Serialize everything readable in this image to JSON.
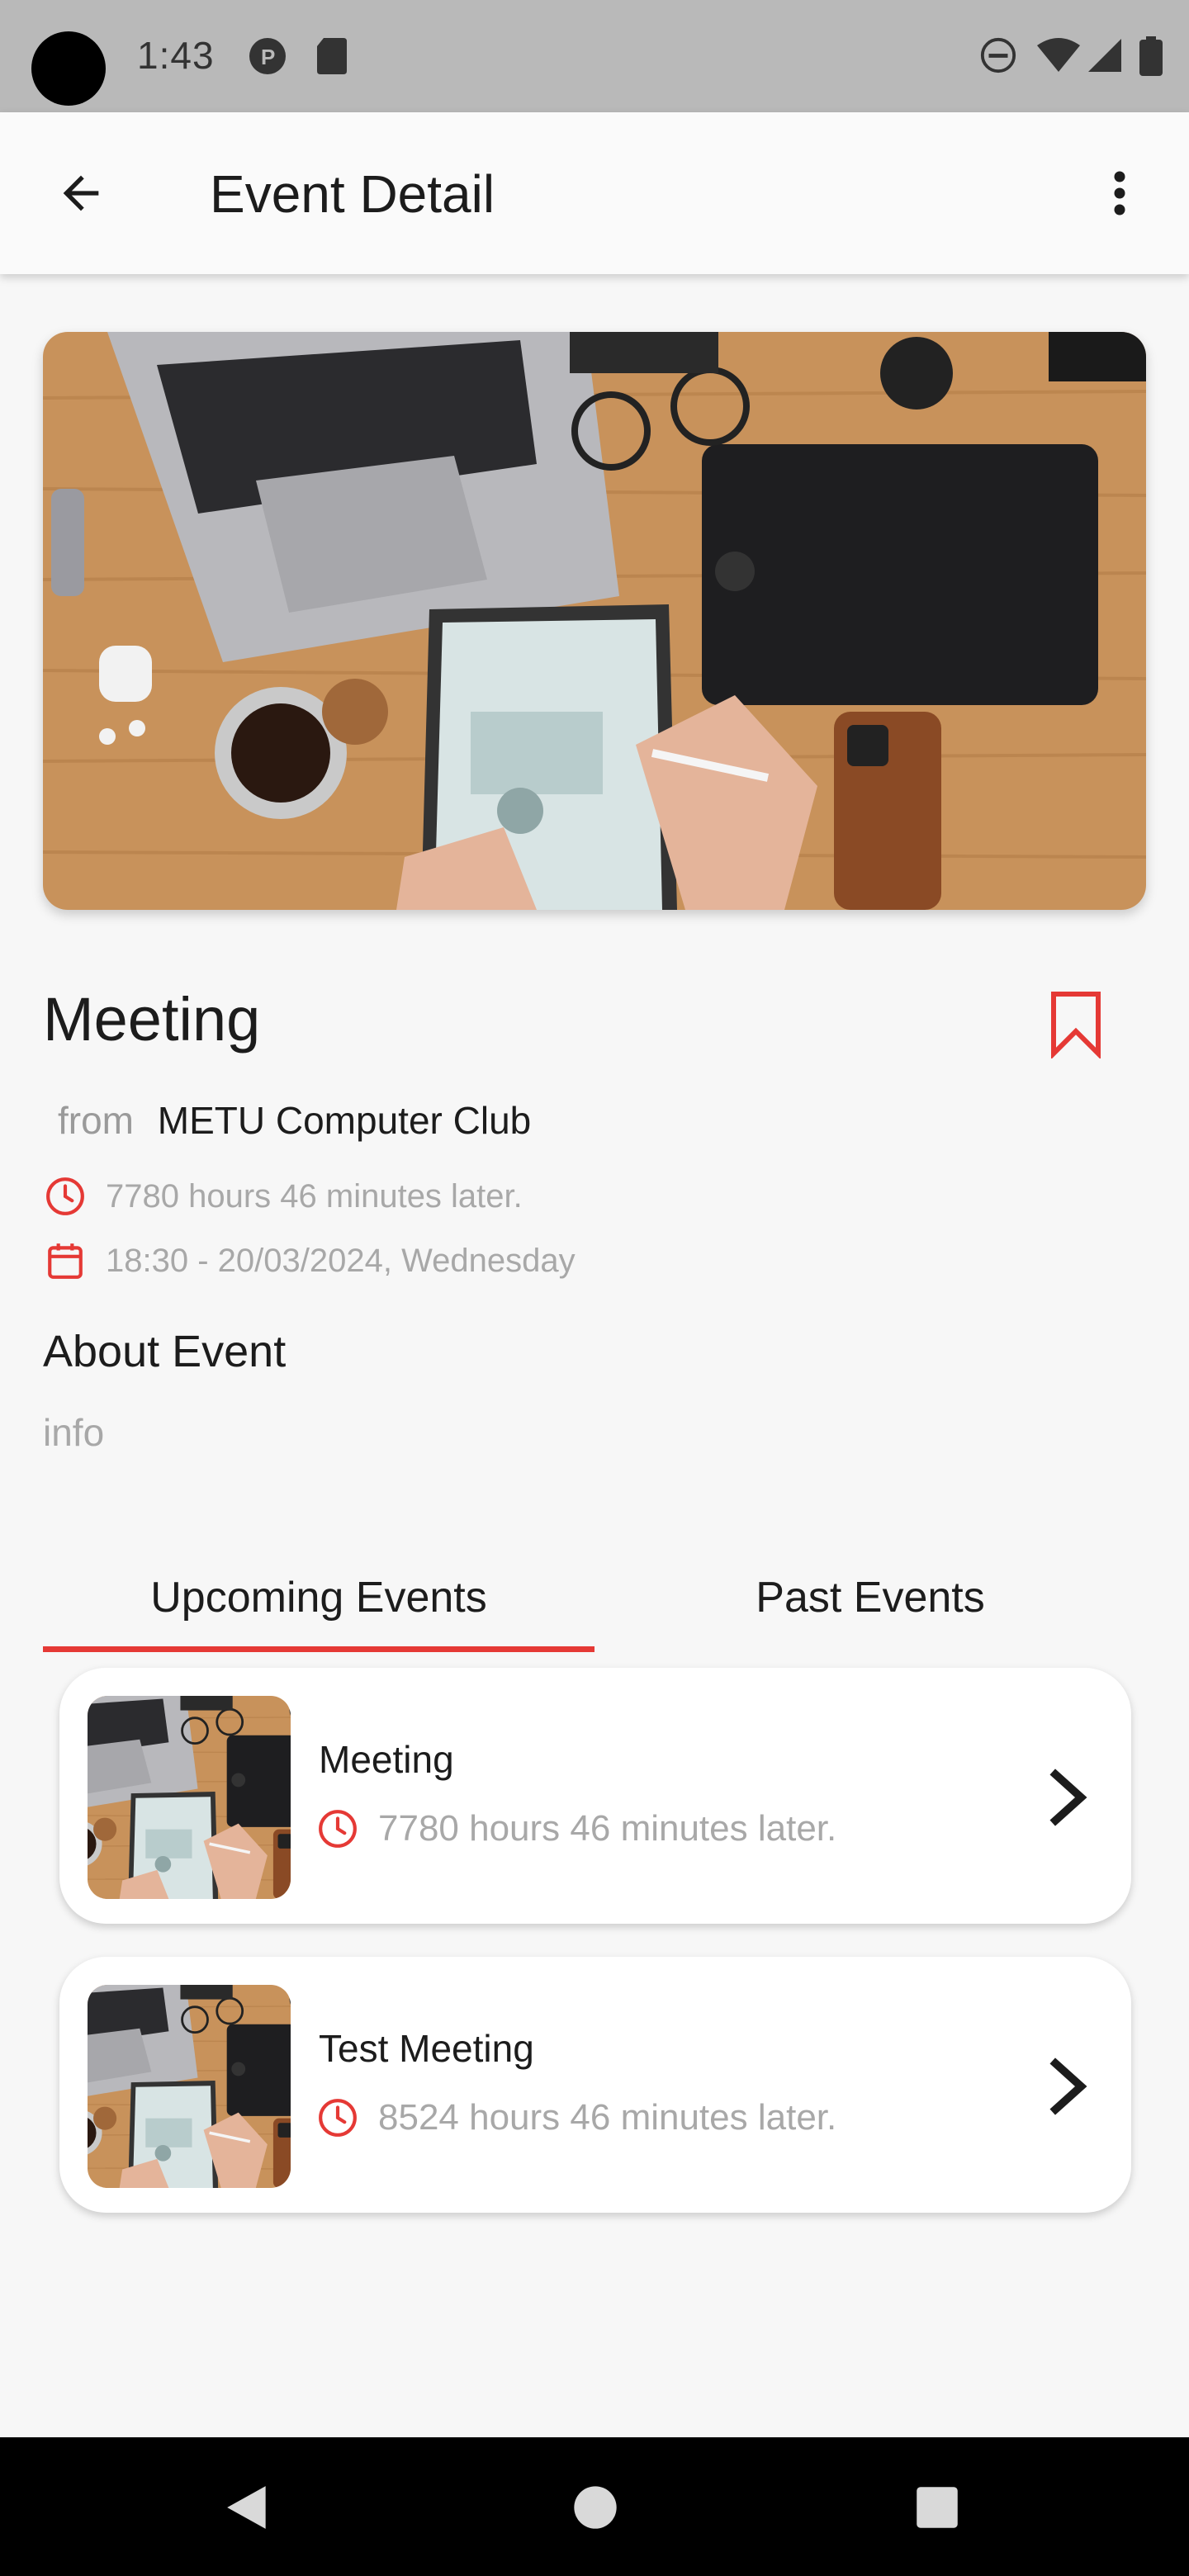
{
  "status_bar": {
    "time": "1:43",
    "icons": [
      "notification-p-icon",
      "sd-card-icon",
      "do-not-disturb-icon",
      "wifi-icon",
      "signal-icon",
      "battery-icon"
    ]
  },
  "app_bar": {
    "title": "Event Detail",
    "back_icon": "arrow-back-icon",
    "menu_icon": "more-vert-icon"
  },
  "event": {
    "hero_image": "desk-workspace-photo",
    "title": "Meeting",
    "bookmark_icon": "bookmark-icon",
    "from_label": "from",
    "organizer": "METU Computer Club",
    "time_until": "7780 hours 46 minutes later.",
    "datetime": "18:30 - 20/03/2024, Wednesday",
    "about_heading": "About Event",
    "about_body": "info"
  },
  "tabs": {
    "items": [
      {
        "label": "Upcoming Events",
        "active": true
      },
      {
        "label": "Past Events",
        "active": false
      }
    ],
    "accent_color": "#e53935"
  },
  "event_list": [
    {
      "title": "Meeting",
      "time_until": "7780 hours 46 minutes later."
    },
    {
      "title": "Test Meeting",
      "time_until": "8524 hours 46 minutes later."
    }
  ],
  "nav_bar": {
    "icons": [
      "back-triangle-icon",
      "home-circle-icon",
      "recents-square-icon"
    ]
  },
  "colors": {
    "accent": "#e53935",
    "muted_text": "#a8a8a8",
    "primary_text": "#1c1c1c"
  }
}
